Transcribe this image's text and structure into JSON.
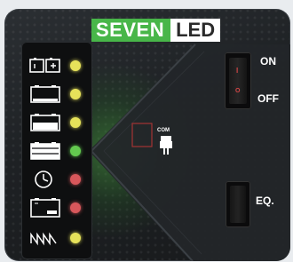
{
  "brand": {
    "name_primary": "SEVEN",
    "name_secondary": "LED",
    "primary_color": "#48b649"
  },
  "indicators": [
    {
      "icon": "battery-pair-icon",
      "led_color": "#e6e25a"
    },
    {
      "icon": "battery-low-icon",
      "led_color": "#e6e25a"
    },
    {
      "icon": "battery-half-icon",
      "led_color": "#e6e25a"
    },
    {
      "icon": "battery-full-icon",
      "led_color": "#63c94f"
    },
    {
      "icon": "clock-icon",
      "led_color": "#d8575b"
    },
    {
      "icon": "battery-max-icon",
      "led_color": "#d8575b"
    },
    {
      "icon": "sawtooth-wave-icon",
      "led_color": "#e6e25a"
    }
  ],
  "com_port": {
    "label": "COM",
    "icon": "usb-plug-icon"
  },
  "power_switch": {
    "on_label": "ON",
    "off_label": "OFF",
    "on_mark": "I",
    "off_mark": "O"
  },
  "eq_switch": {
    "label": "EQ."
  }
}
